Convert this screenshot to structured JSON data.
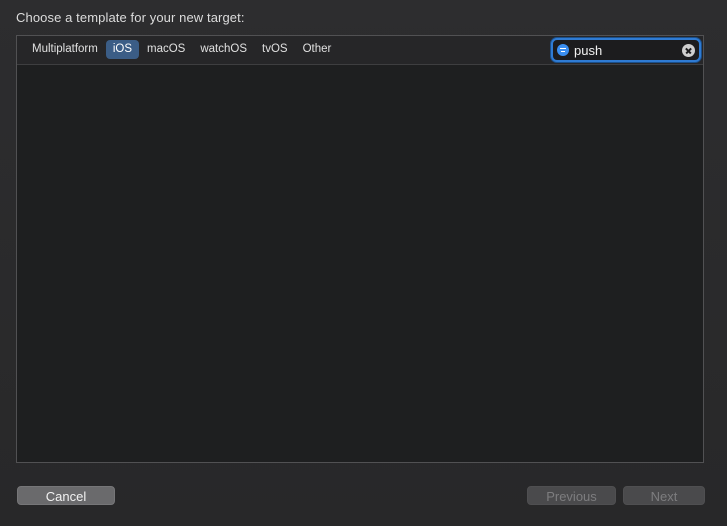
{
  "dialog": {
    "heading": "Choose a template for your new target:"
  },
  "platform_tabs": [
    {
      "label": "Multiplatform",
      "selected": false
    },
    {
      "label": "iOS",
      "selected": true
    },
    {
      "label": "macOS",
      "selected": false
    },
    {
      "label": "watchOS",
      "selected": false
    },
    {
      "label": "tvOS",
      "selected": false
    },
    {
      "label": "Other",
      "selected": false
    }
  ],
  "search": {
    "value": "push",
    "icon": "filter-icon",
    "clear_icon": "clear-icon"
  },
  "buttons": {
    "cancel": "Cancel",
    "previous": "Previous",
    "next": "Next"
  },
  "colors": {
    "accent": "#2f7bd3",
    "selected_tab": "#3b5d86",
    "background": "#2a2a2c",
    "panel": "#1e1f20"
  }
}
